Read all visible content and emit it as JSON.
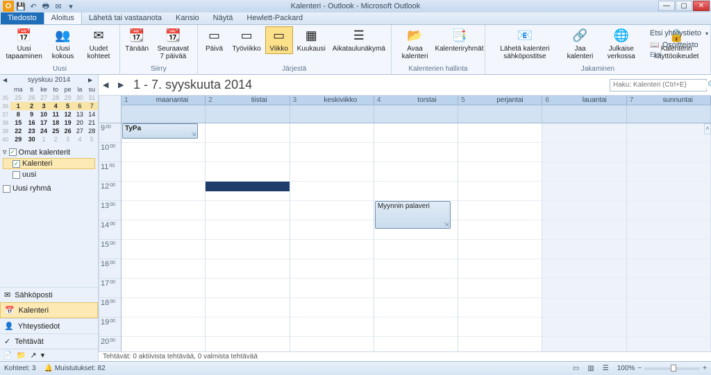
{
  "title": "Kalenteri - Outlook - Microsoft Outlook",
  "tabs": {
    "file": "Tiedosto",
    "home": "Aloitus",
    "sendreceive": "Lähetä tai vastaanota",
    "folder": "Kansio",
    "view": "Näytä",
    "hp": "Hewlett-Packard"
  },
  "ribbon": {
    "new_group": "Uusi",
    "new_appt": "Uusi tapaaminen",
    "new_meeting": "Uusi kokous",
    "new_items": "Uudet kohteet",
    "goto_group": "Siirry",
    "today": "Tänään",
    "next7": "Seuraavat 7 päivää",
    "arrange_group": "Järjestä",
    "day": "Päivä",
    "workweek": "Työviikko",
    "week": "Viikko",
    "month": "Kuukausi",
    "schedule": "Aikataulunäkymä",
    "manage_group": "Kalenterien hallinta",
    "open_cal": "Avaa kalenteri",
    "cal_groups": "Kalenteriryhmät",
    "share_group": "Jakaminen",
    "email_cal": "Lähetä kalenteri sähköpostitse",
    "share_cal": "Jaa kalenteri",
    "publish": "Julkaise verkossa",
    "perms": "Kalenterin käyttöoikeudet",
    "find_group": "Etsi",
    "find_contact": "Etsi yhteystieto",
    "addrbook": "Osoitteisto"
  },
  "minical": {
    "month": "syyskuu 2014",
    "dow": [
      "ma",
      "ti",
      "ke",
      "to",
      "pe",
      "la",
      "su"
    ],
    "rows": [
      [
        {
          "d": 25,
          "o": 1
        },
        {
          "d": 26,
          "o": 1
        },
        {
          "d": 27,
          "o": 1
        },
        {
          "d": 28,
          "o": 1
        },
        {
          "d": 29,
          "o": 1
        },
        {
          "d": 30,
          "o": 1
        },
        {
          "d": 31,
          "o": 1
        }
      ],
      [
        {
          "d": 1,
          "h": 1,
          "b": 1
        },
        {
          "d": 2,
          "h": 1,
          "b": 1
        },
        {
          "d": 3,
          "h": 1,
          "b": 1
        },
        {
          "d": 4,
          "h": 1,
          "b": 1
        },
        {
          "d": 5,
          "h": 1,
          "b": 1
        },
        {
          "d": 6,
          "h": 1
        },
        {
          "d": 7,
          "h": 1
        }
      ],
      [
        {
          "d": 8,
          "b": 1
        },
        {
          "d": 9,
          "b": 1
        },
        {
          "d": 10,
          "b": 1
        },
        {
          "d": 11,
          "b": 1
        },
        {
          "d": 12,
          "b": 1
        },
        {
          "d": 13
        },
        {
          "d": 14
        }
      ],
      [
        {
          "d": 15,
          "b": 1
        },
        {
          "d": 16,
          "b": 1
        },
        {
          "d": 17,
          "b": 1
        },
        {
          "d": 18,
          "b": 1
        },
        {
          "d": 19,
          "b": 1
        },
        {
          "d": 20
        },
        {
          "d": 21
        }
      ],
      [
        {
          "d": 22,
          "b": 1
        },
        {
          "d": 23,
          "b": 1
        },
        {
          "d": 24,
          "b": 1
        },
        {
          "d": 25,
          "b": 1
        },
        {
          "d": 26,
          "b": 1
        },
        {
          "d": 27
        },
        {
          "d": 28
        }
      ],
      [
        {
          "d": 29,
          "b": 1
        },
        {
          "d": 30,
          "b": 1
        },
        {
          "d": 1,
          "o": 1
        },
        {
          "d": 2,
          "o": 1
        },
        {
          "d": 3,
          "o": 1
        },
        {
          "d": 4,
          "o": 1
        },
        {
          "d": 5,
          "o": 1
        }
      ]
    ],
    "weeknums": [
      35,
      36,
      37,
      38,
      39,
      40
    ]
  },
  "tree": {
    "root": "Omat kalenterit",
    "item1": "Kalenteri",
    "item2": "uusi",
    "item3": "Uusi ryhmä"
  },
  "leftnav": {
    "mail": "Sähköposti",
    "calendar": "Kalenteri",
    "contacts": "Yhteystiedot",
    "tasks": "Tehtävät"
  },
  "calendar": {
    "range": "1 - 7. syyskuuta 2014",
    "search_ph": "Haku: Kalenteri (Ctrl+E)",
    "days": [
      {
        "n": "1",
        "label": "maanantai"
      },
      {
        "n": "2",
        "label": "tiistai"
      },
      {
        "n": "3",
        "label": "keskiviikko"
      },
      {
        "n": "4",
        "label": "torstai"
      },
      {
        "n": "5",
        "label": "perjantai"
      },
      {
        "n": "6",
        "label": "lauantai"
      },
      {
        "n": "7",
        "label": "sunnuntai"
      }
    ],
    "hours": [
      9,
      10,
      11,
      12,
      13,
      14,
      15,
      16,
      17,
      18,
      19,
      20
    ],
    "appt1": "TyPa",
    "appt2": "Myynnin palaveri",
    "tasks_line": "Tehtävät: 0 aktiivista tehtävää, 0 valmista tehtävää"
  },
  "status": {
    "items": "Kohteet: 3",
    "reminders": "Muistutukset: 82",
    "zoom": "100%"
  }
}
